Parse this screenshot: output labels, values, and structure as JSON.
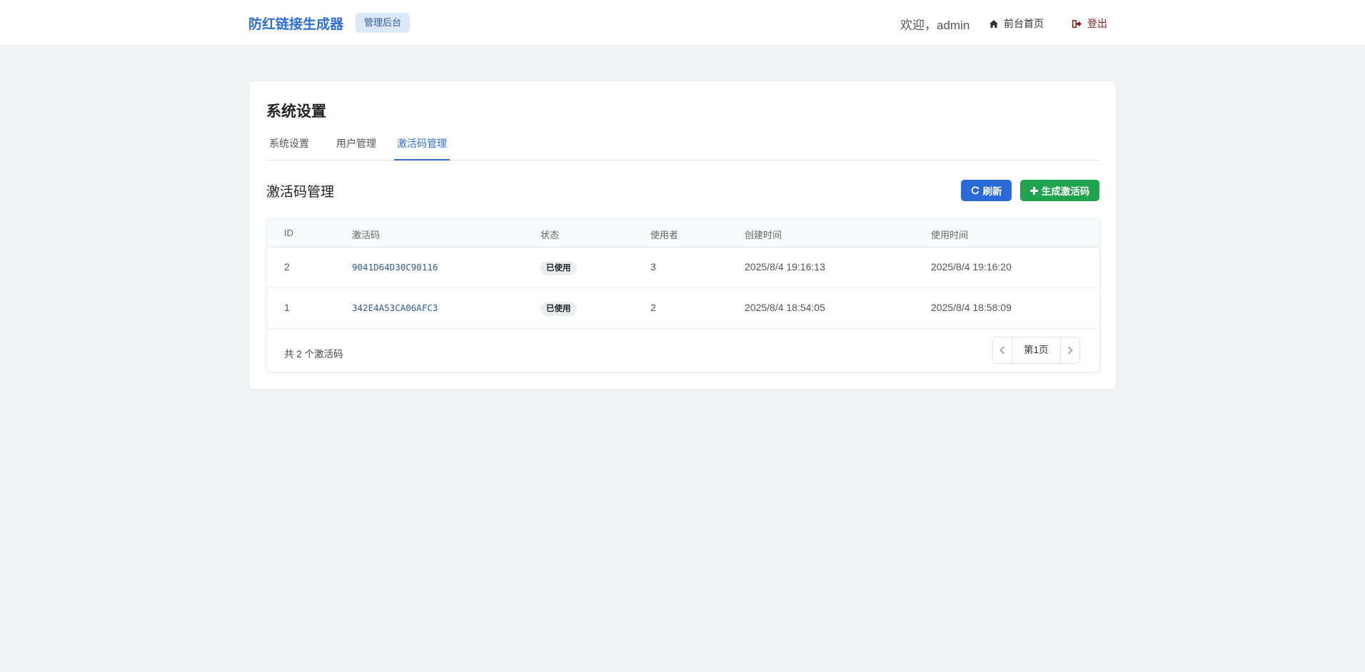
{
  "header": {
    "brand": "防红链接生成器",
    "badge": "管理后台",
    "welcome": "欢迎，admin",
    "home_label": "前台首页",
    "logout_label": "登出",
    "home_icon": "home-icon",
    "logout_icon": "sign-out-icon"
  },
  "page": {
    "title": "系统设置",
    "tabs": [
      {
        "label": "系统设置",
        "active": false
      },
      {
        "label": "用户管理",
        "active": false
      },
      {
        "label": "激活码管理",
        "active": true
      }
    ],
    "section_title": "激活码管理",
    "refresh_label": "刷新",
    "generate_label": "生成激活码",
    "refresh_icon": "refresh-icon",
    "generate_icon": "plus-icon"
  },
  "table": {
    "columns": [
      "ID",
      "激活码",
      "状态",
      "使用者",
      "创建时间",
      "使用时间"
    ],
    "rows": [
      {
        "id": "2",
        "code": "9041D64D30C90116",
        "status": "已使用",
        "user": "3",
        "created": "2025/8/4 19:16:13",
        "used": "2025/8/4 19:16:20"
      },
      {
        "id": "1",
        "code": "342E4A53CA06AFC3",
        "status": "已使用",
        "user": "2",
        "created": "2025/8/4 18:54:05",
        "used": "2025/8/4 18:58:09"
      }
    ],
    "total_text": "共 2 个激活码",
    "page_label": "第1页"
  },
  "colors": {
    "primary": "#2a6ad8",
    "success": "#1fa34e",
    "brand": "#2f6fd0",
    "logout": "#8a1a1a"
  }
}
